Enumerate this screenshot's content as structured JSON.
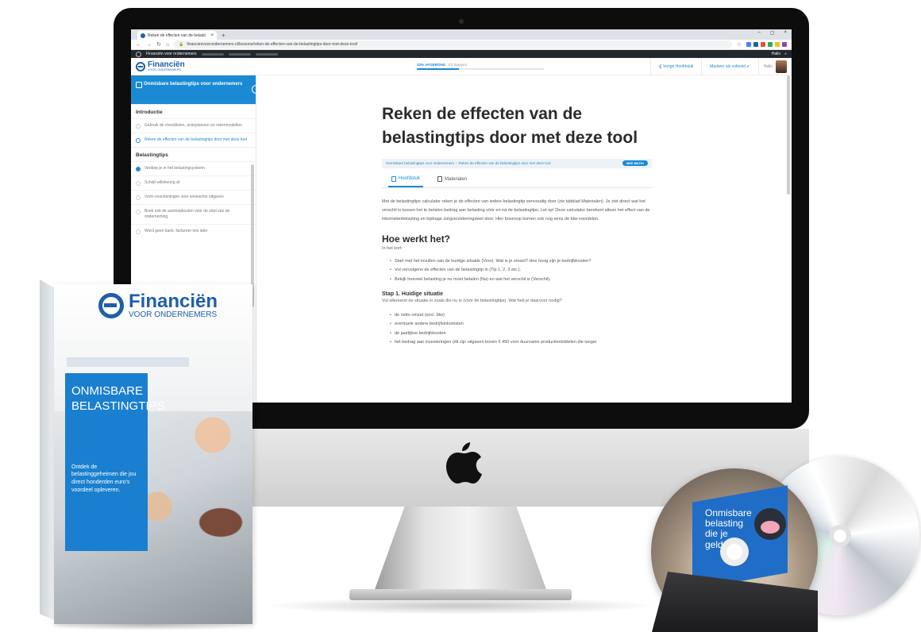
{
  "browser": {
    "tab_title": "Reken de effecten van de belasti",
    "tab_close": "×",
    "new_tab": "+",
    "window_controls": [
      "–",
      "▢",
      "×"
    ],
    "url": "financienvoorondernemers.nl/lessons/reken-de-effecten-van-de-belastingtips-door-met-deze-tool/"
  },
  "wp_bar": {
    "site_name": "Financiën voor ondernemers",
    "greeting": "Hallo"
  },
  "header": {
    "logo_name": "Financiën",
    "logo_sub": "VOOR ONDERNEMERS",
    "progress_label": "33% AFGEROND",
    "progress_steps": "1/3 Stappen",
    "progress_percent": 33,
    "prev_button": "❮  Vorige Hoofdstuk",
    "complete_button": "Markeer als voltooid ✔",
    "user_greeting": "Hallo"
  },
  "sidebar": {
    "course_title": "Onmisbare belastingtips voor ondernemers",
    "collapse_icon": "‹",
    "sections": [
      {
        "title": "Introductie",
        "items": [
          {
            "label": "Gebruik de checklisten, actieplannen en rekenmodellen",
            "state": "todo"
          },
          {
            "label": "Reken de effecten van de belastingtips door met deze tool",
            "state": "active"
          }
        ]
      },
      {
        "title": "Belastingtips",
        "items": [
          {
            "label": "Verdiep je in het belastingsysteem",
            "state": "done"
          },
          {
            "label": "Schrijf willekeurig af",
            "state": "todo"
          },
          {
            "label": "Vorm voorzieningen voor verwachte uitgaven",
            "state": "todo"
          },
          {
            "label": "Boek ook de aanloopkosten vóór de start van de onderneming",
            "state": "todo"
          },
          {
            "label": "Word geen bank, factureer iets later",
            "state": "todo"
          }
        ]
      }
    ]
  },
  "main": {
    "title": "Reken de effecten van de belastingtips door met deze tool",
    "breadcrumb": [
      "Onmisbare belastingtips voor ondernemers",
      "Reken de effecten van de belastingtips door met deze tool"
    ],
    "breadcrumb_sep": "›",
    "status_badge": "MEE BEZIG",
    "tabs": [
      "Hoofdstuk",
      "Materialen"
    ],
    "intro": "Met de belastingtips calculator reken je de effecten van iedere belastingtip eenvoudig door (zie tabblad Materialen). Je ziet direct wat het verschil is tussen het te betalen bedrag aan belasting vóór en ná de belastingtips. Let op! Deze calculator berekent alleen het effect van de inkomstenbelasting en bijdrage zorgverzekeringswet door. Hier bovenop komen ook nog eens de btw-voordelen.",
    "h2": "Hoe werkt het?",
    "h2_sub": "In het kort:",
    "steps": [
      "Start met het invullen van de huidige situatie (Voor). Wat is je omzet? Hoe hoog zijn je bedrijfskosten?",
      "Vul vervolgens de effecten van de belastingtip in (Tip 1, 2, 3 etc.).",
      "Bekijk hoeveel belasting je nu moet betalen (Na) en wat het verschil is (Verschil)."
    ],
    "h3": "Stap 1. Huidige situatie",
    "h3_sub": "Vul allereerst de situatie in zoals die nu is (vóór de belastingtips). Wat heb je daarvoor nodig?",
    "needs": [
      "de netto omzet (excl. btw)",
      "eventuele andere bedrijfsinkomsten",
      "de jaarlijkse bedrijfskosten",
      "het bedrag aan investeringen (dit zijn uitgaven boven € 450 voor duurzame productiemiddelen die langer"
    ]
  },
  "product_box": {
    "logo_name": "Financiën",
    "logo_sub": "VOOR ONDERNEMERS",
    "title_line1": "ONMISBARE",
    "title_line2": "BELASTINGTIPS",
    "tagline": "Ontdek de belastinggeheimen die jou direct honderden euro's voordeel opleveren."
  },
  "dvd": {
    "line1": "Onmisbare",
    "line2": "belasting",
    "line3": "die je",
    "line4": "geld l"
  },
  "colors": {
    "accent": "#1a8ad4",
    "brand_blue": "#1f5fa8",
    "box_panel": "#1a7fcf"
  }
}
